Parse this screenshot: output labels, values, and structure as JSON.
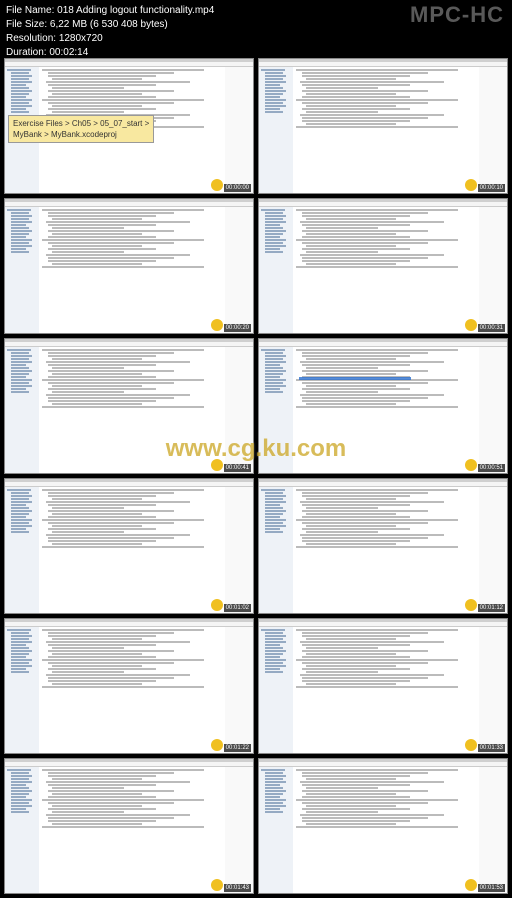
{
  "app": {
    "name": "MPC-HC"
  },
  "header": {
    "file_label": "File Name:",
    "file_value": "018 Adding logout functionality.mp4",
    "size_label": "File Size:",
    "size_value": "6,22 MB (6 530 408 bytes)",
    "res_label": "Resolution:",
    "res_value": "1280x720",
    "dur_label": "Duration:",
    "dur_value": "00:02:14"
  },
  "tooltip": {
    "line1": "Exercise Files > Ch05 > 05_07_start >",
    "line2": "MyBank > MyBank.xcodeproj"
  },
  "watermark": "www.cg.ku.com",
  "thumbnails": [
    {
      "timestamp": "00:00:00"
    },
    {
      "timestamp": "00:00:10"
    },
    {
      "timestamp": "00:00:20"
    },
    {
      "timestamp": "00:00:31"
    },
    {
      "timestamp": "00:00:41"
    },
    {
      "timestamp": "00:00:51"
    },
    {
      "timestamp": "00:01:02"
    },
    {
      "timestamp": "00:01:12"
    },
    {
      "timestamp": "00:01:22"
    },
    {
      "timestamp": "00:01:33"
    },
    {
      "timestamp": "00:01:43"
    },
    {
      "timestamp": "00:01:53"
    }
  ]
}
